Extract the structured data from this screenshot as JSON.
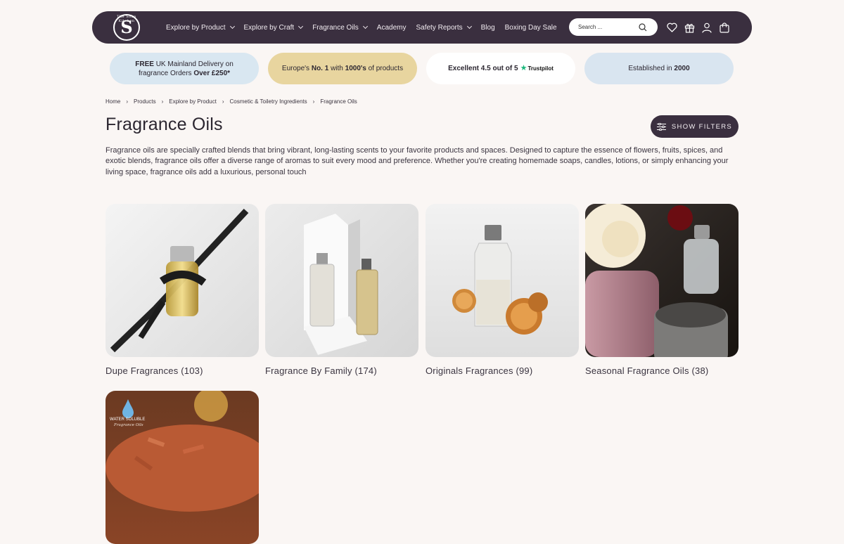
{
  "brand": {
    "logo_letter": "S",
    "logo_ring_text": "The Soap Kitchen"
  },
  "nav": {
    "items": [
      {
        "label": "Explore by Product",
        "dropdown": true
      },
      {
        "label": "Explore by Craft",
        "dropdown": true
      },
      {
        "label": "Fragrance Oils",
        "dropdown": true
      },
      {
        "label": "Academy",
        "dropdown": false
      },
      {
        "label": "Safety Reports",
        "dropdown": true
      },
      {
        "label": "Blog",
        "dropdown": false
      },
      {
        "label": "Boxing Day Sale",
        "dropdown": false
      }
    ],
    "search_placeholder": "Search ...",
    "icons": [
      "heart-icon",
      "gift-icon",
      "user-icon",
      "cart-icon"
    ]
  },
  "badges": {
    "delivery": {
      "pre": "FREE",
      "mid": " UK Mainland Delivery on fragrance Orders ",
      "bold": "Over £250*"
    },
    "europe": {
      "pre": "Europe's ",
      "b1": "No. 1",
      "mid": " with ",
      "b2": "1000's",
      "post": " of products"
    },
    "trustpilot": {
      "text": "Excellent 4.5 out of 5",
      "brand": "Trustpilot"
    },
    "established": {
      "pre": "Established in ",
      "year": "2000"
    }
  },
  "breadcrumb": [
    "Home",
    "Products",
    "Explore by Product",
    "Cosmetic & Toiletry Ingredients",
    "Fragrance Oils"
  ],
  "page": {
    "title": "Fragrance Oils",
    "filters_label": "SHOW FILTERS",
    "description": "Fragrance oils are specially crafted blends that bring vibrant, long-lasting scents to your favorite products and spaces. Designed to capture the essence of flowers, fruits, spices, and exotic blends, fragrance oils offer a diverse range of aromas to suit every mood and preference. Whether you're creating homemade soaps, candles, lotions, or simply enhancing your living space, fragrance oils add a luxurious, personal touch"
  },
  "categories": [
    {
      "label": "Dupe Fragrances (103)"
    },
    {
      "label": "Fragrance By Family (174)"
    },
    {
      "label": "Originals Fragrances (99)"
    },
    {
      "label": "Seasonal Fragrance Oils (38)"
    },
    {
      "label": "",
      "image_text_1": "WATER SOLUBLE",
      "image_text_2": "Fragrance Oils"
    }
  ],
  "colors": {
    "nav_bg": "#3a2f3f",
    "page_bg": "#faf6f4",
    "trustpilot_green": "#1bb77b"
  }
}
